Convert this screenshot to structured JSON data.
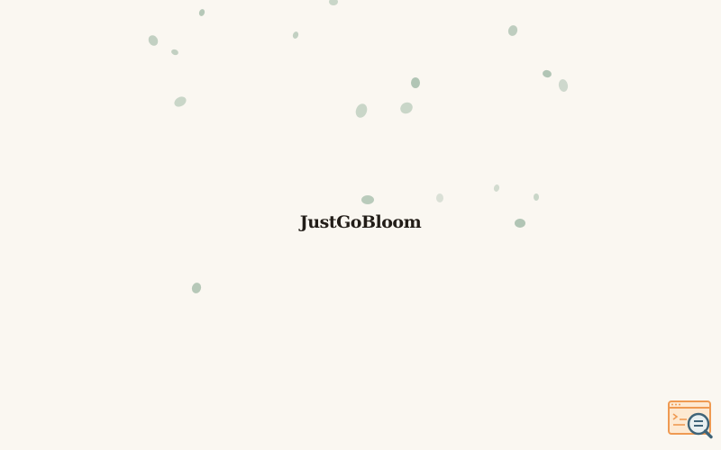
{
  "brand": {
    "name": "JustGoBloom"
  },
  "colors": {
    "background": "#faf7f1",
    "petal": "#a9bfae",
    "brand_text": "#221d18",
    "widget_accent": "#ef9a52",
    "widget_lens": "#3f6478"
  },
  "icons": {
    "decoration": "falling-petals",
    "widget": "inspect-console-icon"
  }
}
